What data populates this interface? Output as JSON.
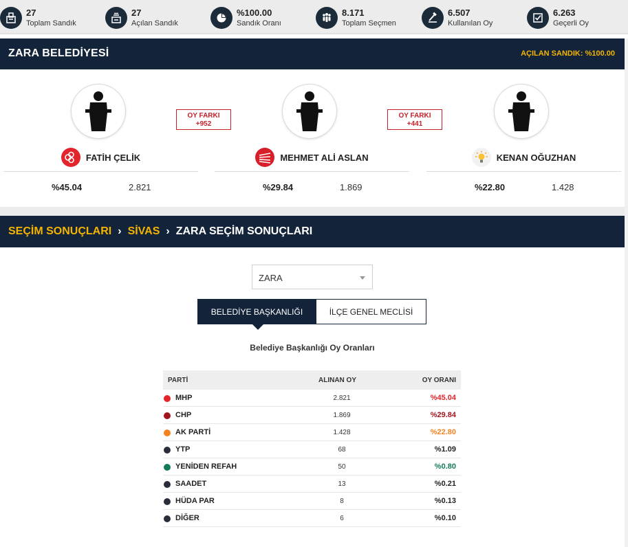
{
  "stats": [
    {
      "value": "27",
      "label": "Toplam Sandık",
      "icon": "ballot-box-icon"
    },
    {
      "value": "27",
      "label": "Açılan Sandık",
      "icon": "opened-ballot-box-icon"
    },
    {
      "value": "%100.00",
      "label": "Sandık Oranı",
      "icon": "pie-chart-icon"
    },
    {
      "value": "8.171",
      "label": "Toplam Seçmen",
      "icon": "voters-icon"
    },
    {
      "value": "6.507",
      "label": "Kullanılan Oy",
      "icon": "vote-cast-icon"
    },
    {
      "value": "6.263",
      "label": "Geçerli Oy",
      "icon": "checkbox-icon"
    }
  ],
  "municipality": {
    "title": "ZARA BELEDİYESİ",
    "opened": "AÇILAN SANDIK: %100.00"
  },
  "candidates": [
    {
      "name": "FATİH ÇELİK",
      "party_logo": "mhp-logo-icon",
      "pct": "%45.04",
      "votes": "2.821"
    },
    {
      "name": "MEHMET ALİ ASLAN",
      "party_logo": "chp-logo-icon",
      "pct": "%29.84",
      "votes": "1.869"
    },
    {
      "name": "KENAN OĞUZHAN",
      "party_logo": "ak-parti-logo-icon",
      "pct": "%22.80",
      "votes": "1.428"
    }
  ],
  "differences": [
    {
      "label": "OY FARKI",
      "value": "+952"
    },
    {
      "label": "OY FARKI",
      "value": "+441"
    }
  ],
  "breadcrumb": {
    "items": [
      "SEÇİM SONUÇLARI",
      "SİVAS",
      "ZARA SEÇİM SONUÇLARI"
    ]
  },
  "district_select": {
    "value": "ZARA"
  },
  "tabs": [
    {
      "label": "BELEDİYE BAŞKANLIĞI",
      "active": true
    },
    {
      "label": "İLÇE GENEL MECLİSİ",
      "active": false
    }
  ],
  "table": {
    "caption": "Belediye Başkanlığı Oy Oranları",
    "headers": {
      "party": "PARTİ",
      "votes": "ALINAN OY",
      "pct": "OY ORANI"
    },
    "rows": [
      {
        "party": "MHP",
        "votes": "2.821",
        "pct": "%45.04",
        "color": "#e3242b"
      },
      {
        "party": "CHP",
        "votes": "1.869",
        "pct": "%29.84",
        "color": "#a3151d"
      },
      {
        "party": "AK PARTİ",
        "votes": "1.428",
        "pct": "%22.80",
        "color": "#f5821f"
      },
      {
        "party": "YTP",
        "votes": "68",
        "pct": "%1.09",
        "color": "#2a2d3a"
      },
      {
        "party": "YENİDEN REFAH",
        "votes": "50",
        "pct": "%0.80",
        "color": "#147a5c"
      },
      {
        "party": "SAADET",
        "votes": "13",
        "pct": "%0.21",
        "color": "#2a2d3a"
      },
      {
        "party": "HÜDA PAR",
        "votes": "8",
        "pct": "%0.13",
        "color": "#2a2d3a"
      },
      {
        "party": "DİĞER",
        "votes": "6",
        "pct": "%0.10",
        "color": "#2a2d3a"
      }
    ]
  },
  "colors": {
    "navy": "#13243a",
    "accent_yellow": "#f4b400",
    "diff_red": "#c51f2a"
  }
}
